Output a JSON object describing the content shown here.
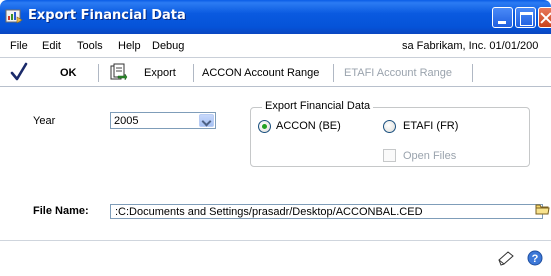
{
  "window": {
    "title": "Export Financial Data"
  },
  "menu": {
    "items": [
      "File",
      "Edit",
      "Tools",
      "Help",
      "Debug"
    ],
    "company": "sa  Fabrikam, Inc.  01/01/200"
  },
  "toolbar": {
    "ok_label": "OK",
    "export_label": "Export",
    "accon_range_label": "ACCON Account Range",
    "etafi_range_label": "ETAFI Account Range"
  },
  "form": {
    "year_label": "Year",
    "year_value": "2005",
    "group_title": "Export Financial Data",
    "radio_accon": {
      "label": "ACCON (BE)",
      "checked": true
    },
    "radio_etafi": {
      "label": "ETAFI (FR)",
      "checked": false
    },
    "open_files": {
      "label": "Open Files",
      "checked": false,
      "enabled": false
    },
    "filename_label": "File Name:",
    "filename_value": ":C:Documents and Settings/prasadr/Desktop/ACCONBAL.CED"
  },
  "icons": {
    "title": "window-app-icon",
    "ok": "checkmark-icon",
    "export": "export-document-icon",
    "year_dropdown": "chevron-down-icon",
    "folder": "folder-icon",
    "note": "note-icon",
    "help": "help-icon"
  },
  "colors": {
    "titlebar": "#0a5ae0",
    "disabled_text": "#9aa3ad",
    "radio_selected": "#21a121"
  }
}
